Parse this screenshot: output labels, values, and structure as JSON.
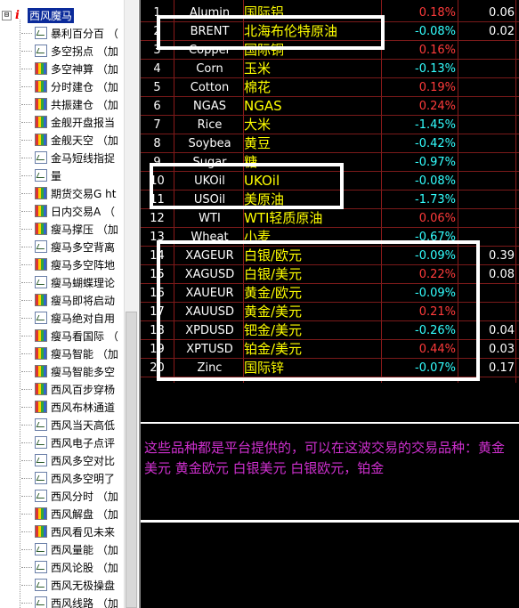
{
  "tree": {
    "expander": "⊟",
    "root_icon": "i",
    "root_label": "西风魔马",
    "items": [
      {
        "label": "暴利百分百 （",
        "icon": "chart-icon"
      },
      {
        "label": "多空拐点 （加",
        "icon": "chart-icon"
      },
      {
        "label": "多空神算 （加",
        "icon": "multicolor-formula-icon"
      },
      {
        "label": "分时建仓 （加",
        "icon": "multicolor-formula-icon"
      },
      {
        "label": "共振建仓 （加",
        "icon": "multicolor-formula-icon"
      },
      {
        "label": "金舰开盘报当",
        "icon": "multicolor-formula-icon"
      },
      {
        "label": "金舰天空 （加",
        "icon": "multicolor-formula-icon"
      },
      {
        "label": "金马短线指捉",
        "icon": "chart-icon"
      },
      {
        "label": "量",
        "icon": "chart-icon"
      },
      {
        "label": "期货交易G ht",
        "icon": "multicolor-formula-icon"
      },
      {
        "label": "日内交易A （",
        "icon": "multicolor-formula-icon"
      },
      {
        "label": "瘦马撑压 （加",
        "icon": "multicolor-formula-icon"
      },
      {
        "label": "瘦马多空背离",
        "icon": "chart-icon"
      },
      {
        "label": "瘦马多空阵地",
        "icon": "multicolor-formula-icon"
      },
      {
        "label": "瘦马蝴蝶理论",
        "icon": "chart-icon"
      },
      {
        "label": "瘦马即将启动",
        "icon": "multicolor-formula-icon"
      },
      {
        "label": "瘦马绝对自用",
        "icon": "chart-icon"
      },
      {
        "label": "瘦马看国际 （",
        "icon": "multicolor-formula-icon"
      },
      {
        "label": "瘦马智能 （加",
        "icon": "multicolor-formula-icon"
      },
      {
        "label": "瘦马智能多空",
        "icon": "multicolor-formula-icon"
      },
      {
        "label": "西风百步穿杨",
        "icon": "multicolor-formula-icon"
      },
      {
        "label": "西风布林通道",
        "icon": "multicolor-formula-icon"
      },
      {
        "label": "西风当天高低",
        "icon": "chart-icon"
      },
      {
        "label": "西风电子点评",
        "icon": "chart-icon"
      },
      {
        "label": "西风多空对比",
        "icon": "chart-icon"
      },
      {
        "label": "西风多空明了",
        "icon": "chart-icon"
      },
      {
        "label": "西风分时 （加",
        "icon": "chart-icon"
      },
      {
        "label": "西风解盘 （加",
        "icon": "multicolor-formula-icon"
      },
      {
        "label": "西风看见未来",
        "icon": "multicolor-formula-icon"
      },
      {
        "label": "西风量能 （加",
        "icon": "chart-icon"
      },
      {
        "label": "西风论股 （加",
        "icon": "chart-icon"
      },
      {
        "label": "西风无极操盘",
        "icon": "chart-icon"
      },
      {
        "label": "西风线路 （加",
        "icon": "chart-icon"
      }
    ]
  },
  "quotes": [
    {
      "num": "1",
      "code": "Alumin",
      "name": "国际铝",
      "pct": "0.18%",
      "dir": "up",
      "extra": "0.06"
    },
    {
      "num": "2",
      "code": "BRENT",
      "name": "北海布伦特原油",
      "pct": "-0.08%",
      "dir": "down",
      "extra": "0.02"
    },
    {
      "num": "3",
      "code": "Copper",
      "name": "国际铜",
      "pct": "0.16%",
      "dir": "up",
      "extra": ""
    },
    {
      "num": "4",
      "code": "Corn",
      "name": "玉米",
      "pct": "-0.13%",
      "dir": "down",
      "extra": ""
    },
    {
      "num": "5",
      "code": "Cotton",
      "name": "棉花",
      "pct": "0.19%",
      "dir": "up",
      "extra": ""
    },
    {
      "num": "6",
      "code": "NGAS",
      "name": "NGAS",
      "pct": "0.24%",
      "dir": "up",
      "extra": ""
    },
    {
      "num": "7",
      "code": "Rice",
      "name": "大米",
      "pct": "-1.45%",
      "dir": "down",
      "extra": ""
    },
    {
      "num": "8",
      "code": "Soybea",
      "name": "黄豆",
      "pct": "-0.42%",
      "dir": "down",
      "extra": ""
    },
    {
      "num": "9",
      "code": "Sugar",
      "name": "糖",
      "pct": "-0.97%",
      "dir": "down",
      "extra": ""
    },
    {
      "num": "10",
      "code": "UKOil",
      "name": "UKOil",
      "pct": "-0.08%",
      "dir": "down",
      "extra": ""
    },
    {
      "num": "11",
      "code": "USOil",
      "name": "美原油",
      "pct": "-1.73%",
      "dir": "down",
      "extra": ""
    },
    {
      "num": "12",
      "code": "WTI",
      "name": "WTI轻质原油",
      "pct": "0.06%",
      "dir": "up",
      "extra": ""
    },
    {
      "num": "13",
      "code": "Wheat",
      "name": "小麦",
      "pct": "-0.67%",
      "dir": "down",
      "extra": ""
    },
    {
      "num": "14",
      "code": "XAGEUR",
      "name": "白银/欧元",
      "pct": "-0.09%",
      "dir": "down",
      "extra": "0.39"
    },
    {
      "num": "15",
      "code": "XAGUSD",
      "name": "白银/美元",
      "pct": "0.22%",
      "dir": "up",
      "extra": "0.08"
    },
    {
      "num": "16",
      "code": "XAUEUR",
      "name": "黄金/欧元",
      "pct": "-0.09%",
      "dir": "down",
      "extra": ""
    },
    {
      "num": "17",
      "code": "XAUUSD",
      "name": "黄金/美元",
      "pct": "0.21%",
      "dir": "up",
      "extra": ""
    },
    {
      "num": "18",
      "code": "XPDUSD",
      "name": "钯金/美元",
      "pct": "-0.26%",
      "dir": "down",
      "extra": "0.04"
    },
    {
      "num": "19",
      "code": "XPTUSD",
      "name": "铂金/美元",
      "pct": "0.44%",
      "dir": "up",
      "extra": "0.03"
    },
    {
      "num": "20",
      "code": "Zinc",
      "name": "国际锌",
      "pct": "-0.07%",
      "dir": "down",
      "extra": "0.17"
    }
  ],
  "note": "这些品种都是平台提供的，可以在这波交易的交易品种：黄金美元 黄金欧元 白银美元 白银欧元，铂金",
  "colors": {
    "up": "#ff3b3b",
    "down": "#33ffff",
    "name": "#ffff00",
    "note": "#d030d0",
    "grid": "#8a1a1a",
    "tree_root_bg": "#0a2a9a"
  }
}
